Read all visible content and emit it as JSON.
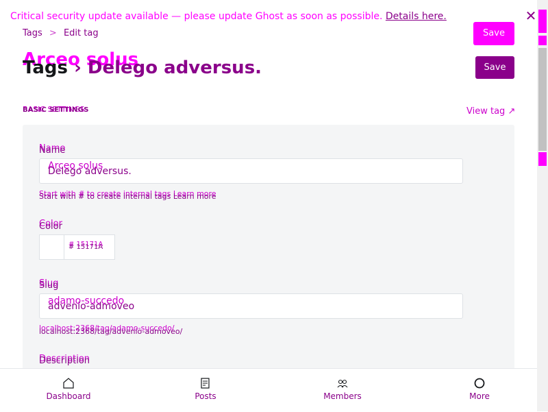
{
  "banner": {
    "message": "Critical security update available — please update Ghost as soon as possible.",
    "link": "Details here."
  },
  "breadcrumb": {
    "root": "Tags",
    "separator": ">",
    "current": "Edit tag"
  },
  "header": {
    "save_top": "Save",
    "save": "Save",
    "title_ghost": "Arceo solus",
    "title_prefix": "Tags",
    "title_sep": "›",
    "title_name": "Delego adversus."
  },
  "section": {
    "heading": "BASIC SETTINGS",
    "heading_ghost": "BASIC SETTINGS",
    "view_tag": "View tag"
  },
  "fields": {
    "name_label": "Name",
    "name_label_ghost": "Name",
    "name_value": "Delego adversus.",
    "name_value_ghost": "Arceo solus",
    "name_hint": "Start with # to create internal tags Learn more",
    "name_hint_ghost": "Start with # to create internal tags Learn more",
    "color_label": "Color",
    "color_label_ghost": "Color",
    "color_value": "# 15171A",
    "color_value_ghost": "# 15171A",
    "slug_label": "Slug",
    "slug_label_ghost": "Slug",
    "slug_value": "advenio-admoveo",
    "slug_value_ghost": "adamo-succedo",
    "slug_url": "localhost:2368/tag/advenio-admoveo/",
    "slug_url_ghost": "localhost:2368/tag/adamo-succedo/",
    "description_label": "Description",
    "description_label_ghost": "Description"
  },
  "bottom_nav": {
    "items": [
      {
        "label": "Dashboard",
        "icon": "home-icon"
      },
      {
        "label": "Posts",
        "icon": "posts-icon"
      },
      {
        "label": "Members",
        "icon": "members-icon"
      },
      {
        "label": "More",
        "icon": "more-icon"
      }
    ]
  },
  "colors": {
    "accent": "#ff00ff",
    "accent_dark": "#8a008a",
    "panel_bg": "#f4f5f6"
  }
}
